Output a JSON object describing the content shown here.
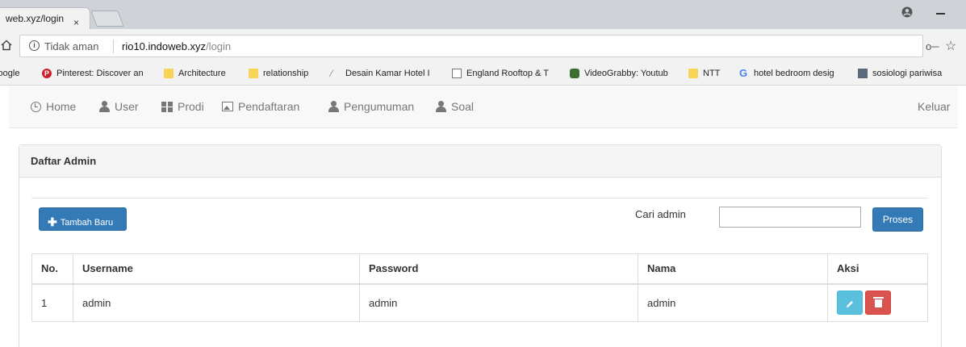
{
  "browser": {
    "tab_title": "web.xyz/login",
    "tab_close": "×",
    "security_text": "Tidak aman",
    "url_host": "rio10.indoweb.xyz",
    "url_path": "/login",
    "bookmarks": [
      {
        "label": "Google",
        "icon": "google-icon"
      },
      {
        "label": "Pinterest: Discover an",
        "icon": "pinterest-icon"
      },
      {
        "label": "Architecture",
        "icon": "folder-icon"
      },
      {
        "label": "relationship",
        "icon": "folder-icon"
      },
      {
        "label": "Desain Kamar Hotel I",
        "icon": "feather-icon"
      },
      {
        "label": "England Rooftop & T",
        "icon": "page-icon"
      },
      {
        "label": "VideoGrabby: Youtub",
        "icon": "videograbby-icon"
      },
      {
        "label": "NTT",
        "icon": "folder-icon"
      },
      {
        "label": "hotel bedroom desig",
        "icon": "google-icon"
      },
      {
        "label": "sosiologi pariwisa",
        "icon": "photo-icon"
      }
    ]
  },
  "nav": {
    "home": "Home",
    "user": "User",
    "prodi": "Prodi",
    "pendaftaran": "Pendaftaran",
    "pengumuman": "Pengumuman",
    "soal": "Soal",
    "logout": "Keluar"
  },
  "panel": {
    "title": "Daftar Admin",
    "add_button": "Tambah Baru",
    "search_label": "Cari admin",
    "search_value": "",
    "search_button": "Proses"
  },
  "table": {
    "headers": [
      "No.",
      "Username",
      "Password",
      "Nama",
      "Aksi"
    ],
    "rows": [
      {
        "no": "1",
        "username": "admin",
        "password": "admin",
        "nama": "admin"
      }
    ]
  },
  "colors": {
    "primary": "#337ab7",
    "info": "#5bc0de",
    "danger": "#d9534f",
    "navbar_bg": "#f8f8f8",
    "panel_heading_bg": "#f5f5f5"
  }
}
